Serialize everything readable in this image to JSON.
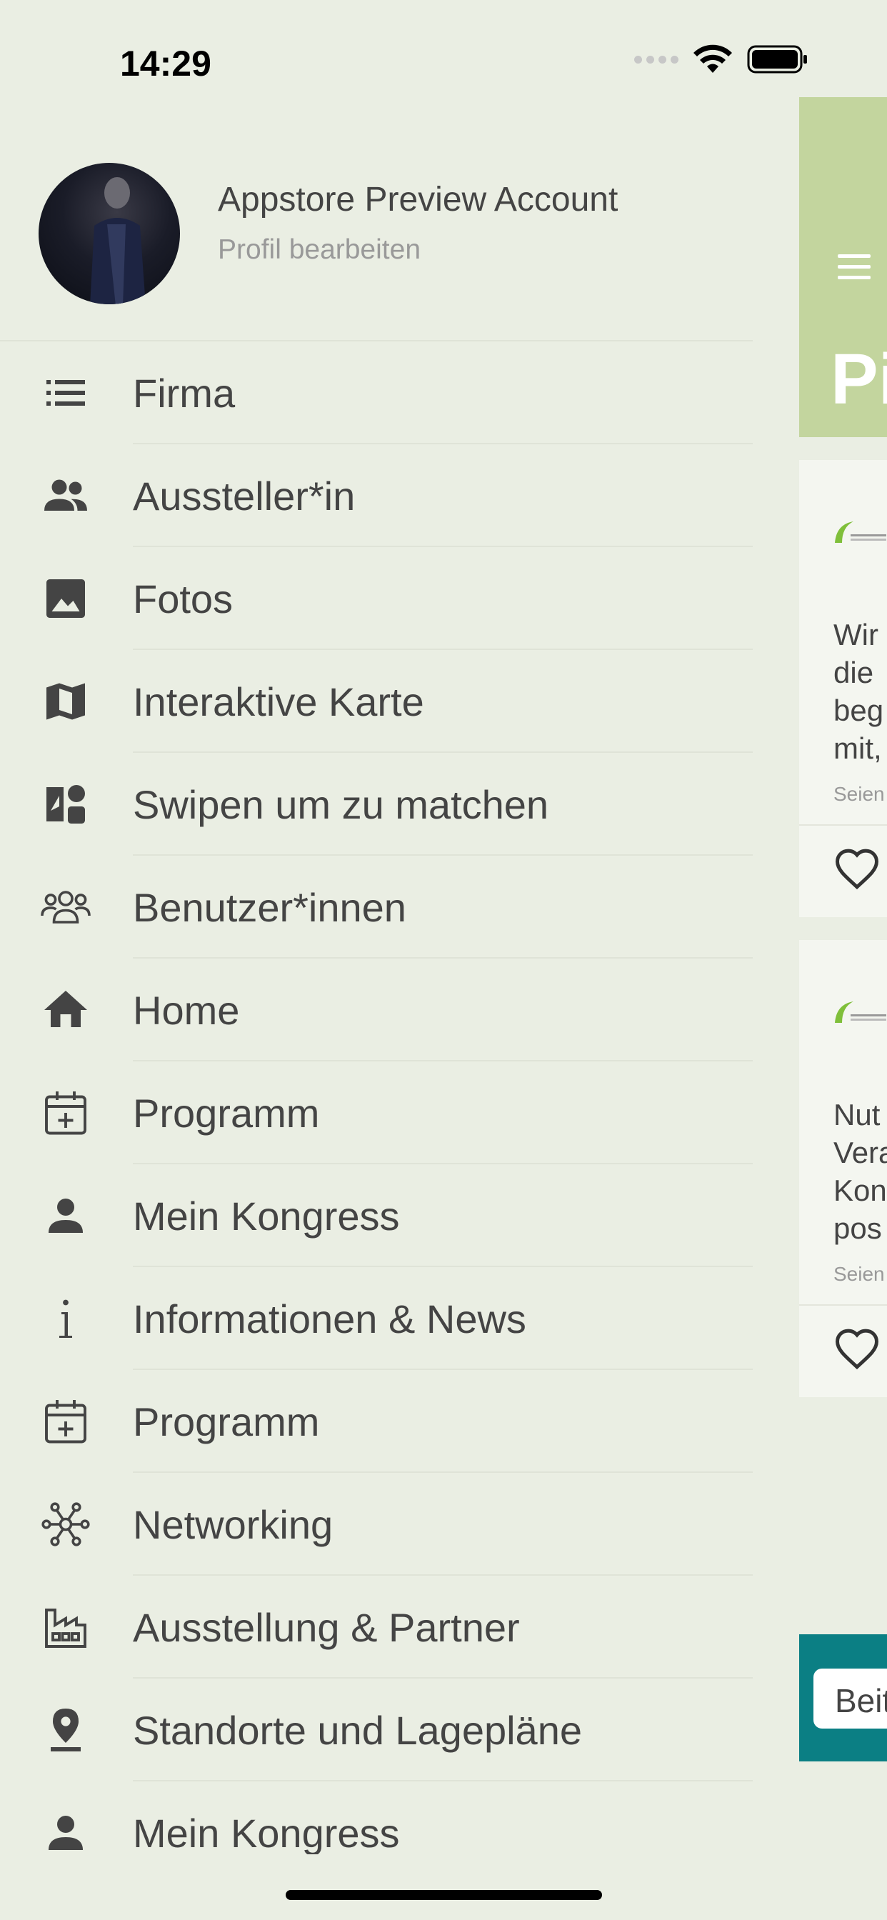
{
  "status_bar": {
    "time": "14:29"
  },
  "profile": {
    "name": "Appstore Preview Account",
    "edit_label": "Profil bearbeiten"
  },
  "menu": {
    "items": [
      {
        "label": "Firma",
        "icon": "list-icon"
      },
      {
        "label": "Aussteller*in",
        "icon": "people-icon"
      },
      {
        "label": "Fotos",
        "icon": "image-icon"
      },
      {
        "label": "Interaktive Karte",
        "icon": "map-icon"
      },
      {
        "label": "Swipen um zu matchen",
        "icon": "swipe-match-icon"
      },
      {
        "label": "Benutzer*innen",
        "icon": "users-outline-icon"
      },
      {
        "label": "Home",
        "icon": "home-icon"
      },
      {
        "label": "Programm",
        "icon": "calendar-plus-icon"
      },
      {
        "label": "Mein Kongress",
        "icon": "person-icon"
      },
      {
        "label": "Informationen & News",
        "icon": "info-icon"
      },
      {
        "label": "Programm",
        "icon": "calendar-plus-icon"
      },
      {
        "label": "Networking",
        "icon": "network-icon"
      },
      {
        "label": "Ausstellung & Partner",
        "icon": "factory-icon"
      },
      {
        "label": "Standorte und Lagepläne",
        "icon": "location-pin-icon"
      },
      {
        "label": "Mein Kongress",
        "icon": "person-icon"
      }
    ]
  },
  "background_page": {
    "title_partial": "Pi",
    "cards": [
      {
        "lines": [
          "Wir",
          "die",
          "beg",
          "mit,"
        ],
        "meta": "Seien"
      },
      {
        "lines": [
          "Nut",
          "Vera",
          "Kon",
          "pos"
        ],
        "meta": "Seien"
      }
    ],
    "footer_button": "Beit"
  },
  "colors": {
    "background": "#eaeee3",
    "header_green": "#c3d59e",
    "footer_teal": "#0b7f84",
    "text": "#444444"
  }
}
